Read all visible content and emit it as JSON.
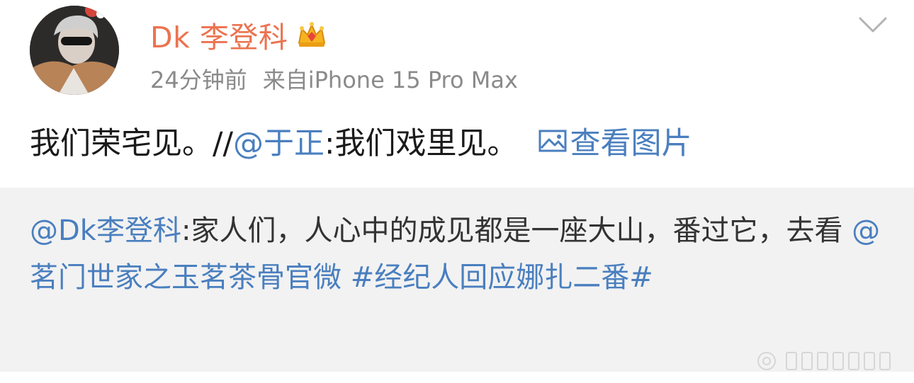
{
  "header": {
    "username": "Dk 李登科",
    "badge_icon": "crown-icon",
    "time": "24分钟前",
    "source": "来自iPhone 15 Pro Max"
  },
  "post": {
    "text_before": "我们荣宅见。//",
    "mention": "@于正",
    "text_after": ":我们戏里见。",
    "view_picture_label": "查看图片"
  },
  "repost": {
    "mention_author": "@Dk李登科",
    "text1": ":家人们，人心中的成见都是一座大山，番过它，去看 ",
    "mention2": "@茗门世家之玉茗茶骨官微",
    "space": " ",
    "hashtag": "#经纪人回应娜扎二番#"
  },
  "colors": {
    "username": "#eb7350",
    "link": "#4a7fbf",
    "meta": "#8a8a8a",
    "repost_bg": "#f2f2f2"
  }
}
